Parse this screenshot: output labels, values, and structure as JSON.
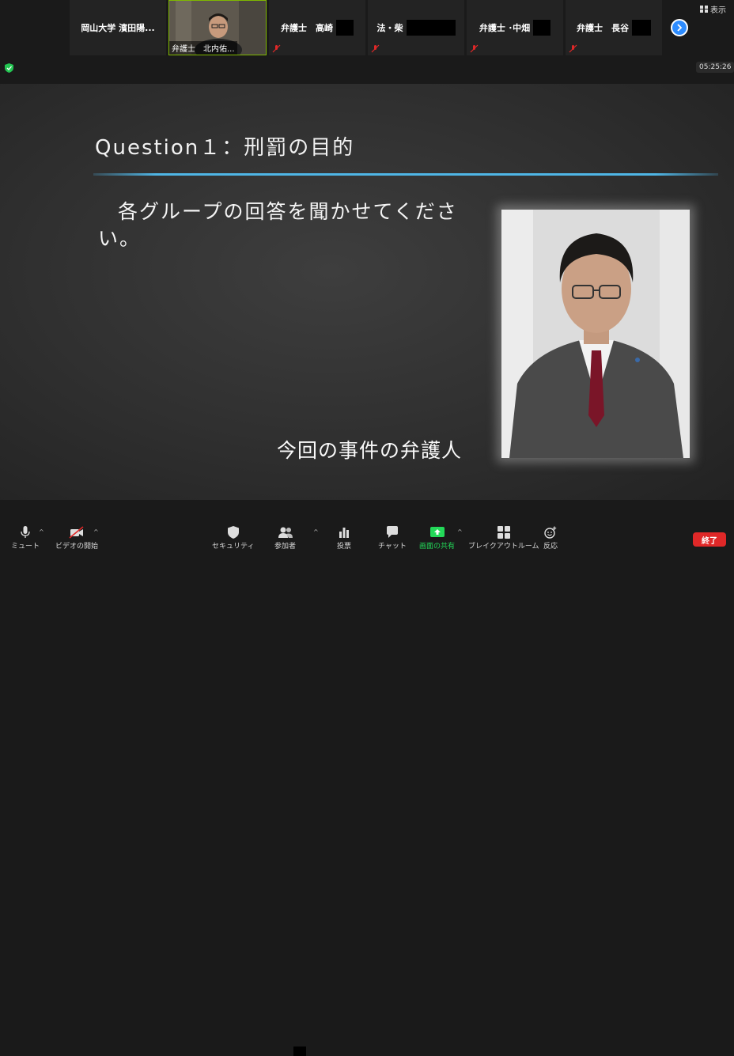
{
  "top_strip": {
    "view_label": "表示",
    "participants": [
      {
        "name": "岡山大学 濱田陽..."
      },
      {
        "name": "弁護士　北内佑..."
      },
      {
        "name": "弁護士　高崎"
      },
      {
        "name": "法・柴"
      },
      {
        "name": "弁護士 ･中畑"
      },
      {
        "name": "弁護士　長谷"
      }
    ]
  },
  "status": {
    "timer": "05:25:26"
  },
  "slide": {
    "title": "Question１：刑罰の目的",
    "body": "各グループの回答を聞かせてください。",
    "caption": "今回の事件の弁護人"
  },
  "toolbar": {
    "mute": "ミュート",
    "start_video": "ビデオの開始",
    "security": "セキュリティ",
    "participants": "参加者",
    "polls": "投票",
    "chat": "チャット",
    "share_screen": "画面の共有",
    "breakout": "ブレイクアウトルーム",
    "reactions": "反応",
    "end": "終了"
  },
  "colors": {
    "share_green": "#23d959",
    "end_red": "#e02828",
    "accent_blue": "#2d8cff",
    "chalk_rule": "#4fb6e6"
  }
}
